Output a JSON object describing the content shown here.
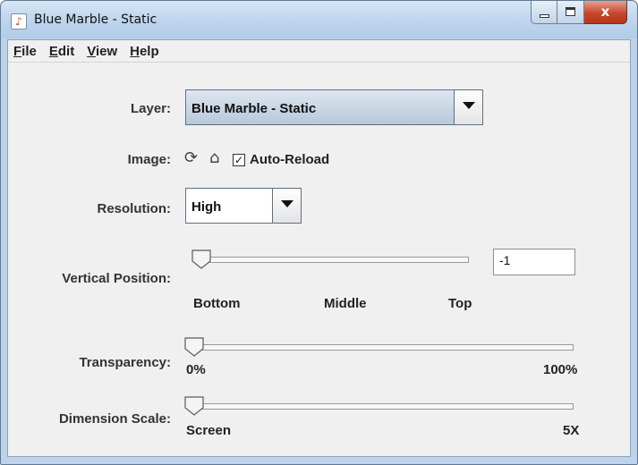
{
  "window": {
    "title": "Blue Marble - Static",
    "close_glyph": "x"
  },
  "menubar": {
    "items": [
      {
        "first": "F",
        "rest": "ile"
      },
      {
        "first": "E",
        "rest": "dit"
      },
      {
        "first": "V",
        "rest": "iew"
      },
      {
        "first": "H",
        "rest": "elp"
      }
    ]
  },
  "layer": {
    "label": "Layer:",
    "value": "Blue Marble - Static"
  },
  "image": {
    "label": "Image:",
    "reload_icon": "reload-icon",
    "save_icon": "save-icon",
    "auto_reload_label": "Auto-Reload",
    "auto_reload_checked": true
  },
  "resolution": {
    "label": "Resolution:",
    "value": "High"
  },
  "vertical_position": {
    "label": "Vertical Position:",
    "value": "-1",
    "slider_fraction": 0,
    "ticks": [
      "Bottom",
      "Middle",
      "Top"
    ]
  },
  "transparency": {
    "label": "Transparency:",
    "slider_fraction": 0,
    "min_label": "0%",
    "max_label": "100%"
  },
  "dimension_scale": {
    "label": "Dimension Scale:",
    "slider_fraction": 0,
    "min_label": "Screen",
    "max_label": "5X"
  }
}
